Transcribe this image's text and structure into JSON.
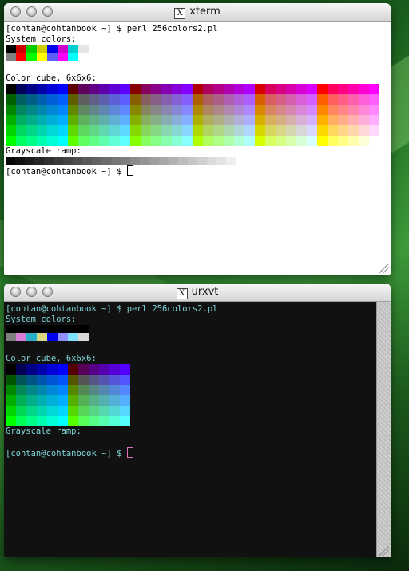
{
  "xterm": {
    "title": "xterm",
    "title_icon": "X",
    "lines": {
      "prompt1": "[cohtan@cohtanbook ~] $ perl 256colors2.pl",
      "system_label": "System colors:",
      "cube_label": "Color cube, 6x6x6:",
      "gray_label": "Grayscale ramp:",
      "prompt2": "[cohtan@cohtanbook ~] $ "
    }
  },
  "urxvt": {
    "title": "urxvt",
    "title_icon": "X",
    "lines": {
      "prompt1": "[cohtan@cohtanbook ~] $ perl 256colors2.pl",
      "system_label": "System colors:",
      "cube_label": "Color cube, 6x6x6:",
      "gray_label": "Grayscale ramp:",
      "prompt2": "[cohtan@cohtanbook ~] $ "
    }
  },
  "colors": {
    "xterm_system_row1": [
      "#000000",
      "#cd0000",
      "#00cd00",
      "#cdcd00",
      "#0000ee",
      "#cd00cd",
      "#00cdcd",
      "#e5e5e5"
    ],
    "xterm_system_row2": [
      "#7f7f7f",
      "#ff0000",
      "#00ff00",
      "#ffff00",
      "#5c5cff",
      "#ff00ff",
      "#00ffff",
      "#ffffff"
    ],
    "urxvt_system_row1": [
      "#000000",
      "#000000",
      "#000000",
      "#000000",
      "#000000",
      "#000000",
      "#000000",
      "#000000"
    ],
    "urxvt_system_row2": [
      "#7f7f7f",
      "#d77fd7",
      "#2ab0c8",
      "#d8d880",
      "#0000ee",
      "#8f8fff",
      "#7fe0ff",
      "#d8d8d8"
    ],
    "cube_levels": [
      0,
      95,
      135,
      175,
      215,
      255
    ],
    "urxvt_cube_levels": [
      0,
      85,
      135,
      175,
      215,
      255
    ]
  }
}
